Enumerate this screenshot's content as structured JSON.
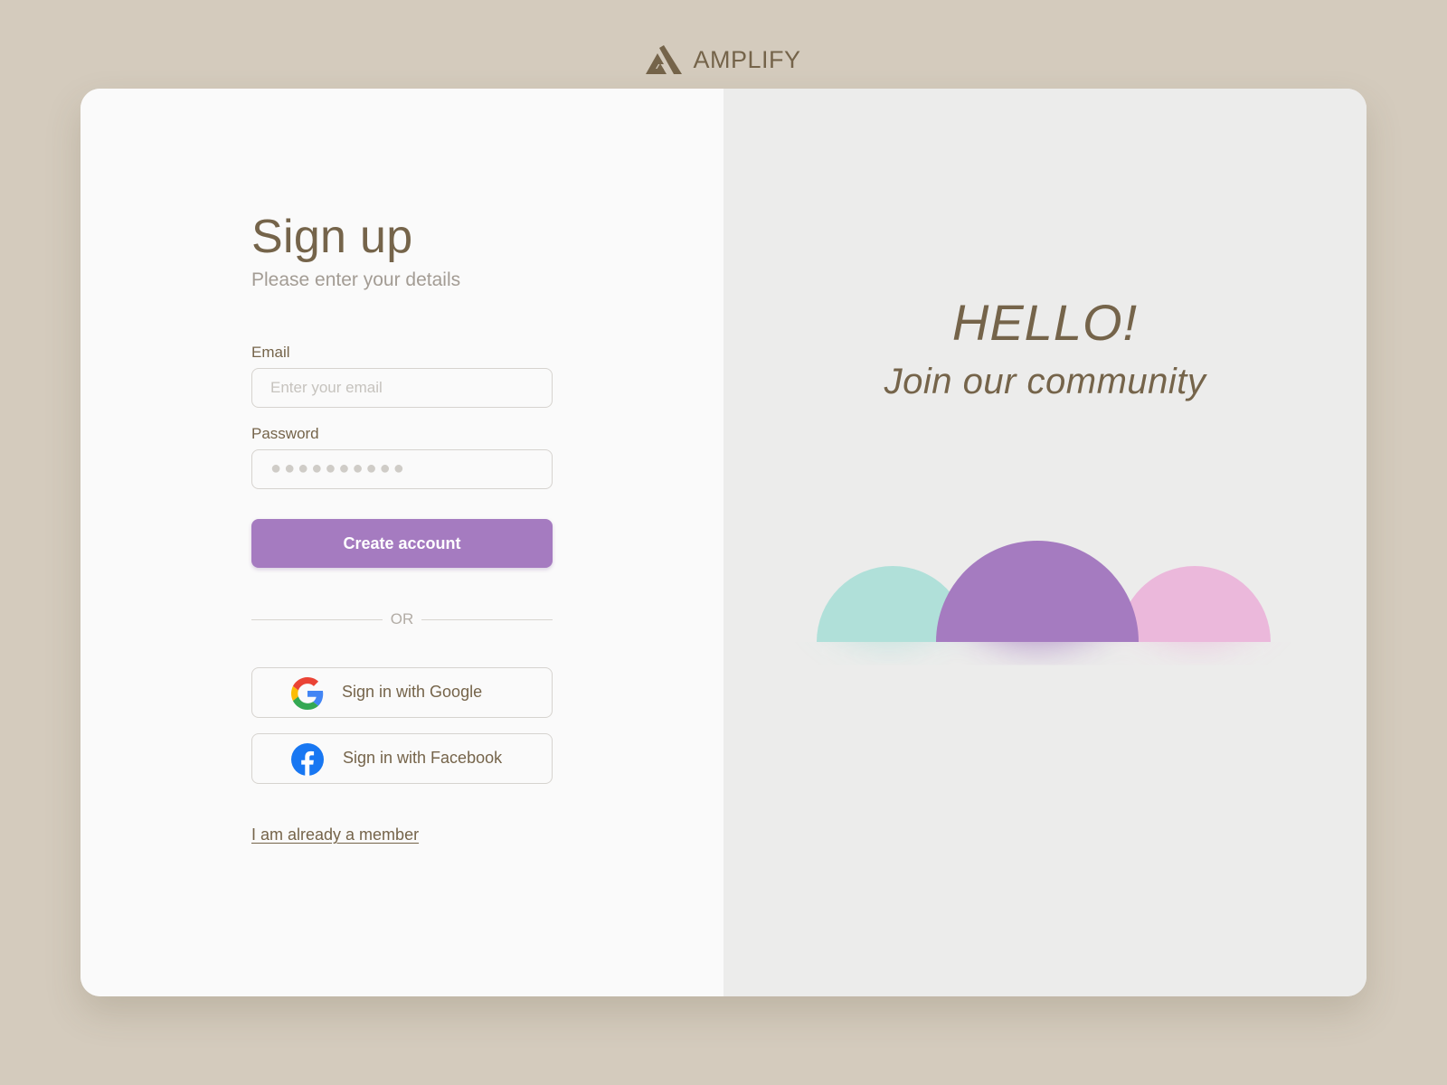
{
  "brand": {
    "name": "AMPLIFY",
    "logo_icon": "amplify-logo-icon"
  },
  "form": {
    "title": "Sign up",
    "subtitle": "Please enter your details",
    "email": {
      "label": "Email",
      "placeholder": "Enter your email",
      "value": ""
    },
    "password": {
      "label": "Password",
      "placeholder": "●●●●●●●●●●",
      "value": ""
    },
    "create_account_label": "Create account",
    "divider_text": "OR",
    "google": {
      "label": "Sign in with Google",
      "icon": "google-icon"
    },
    "facebook": {
      "label": "Sign in with Facebook",
      "icon": "facebook-icon"
    },
    "member_link": "I am already a member"
  },
  "hero": {
    "heading": "HELLO!",
    "tagline": "Join our community"
  },
  "colors": {
    "background": "#d4cbbd",
    "text": "#75644a",
    "accent": "#a57bc0",
    "circle_teal": "#b0e0d9",
    "circle_purple": "#a57bc0",
    "circle_pink": "#ebb8db"
  }
}
